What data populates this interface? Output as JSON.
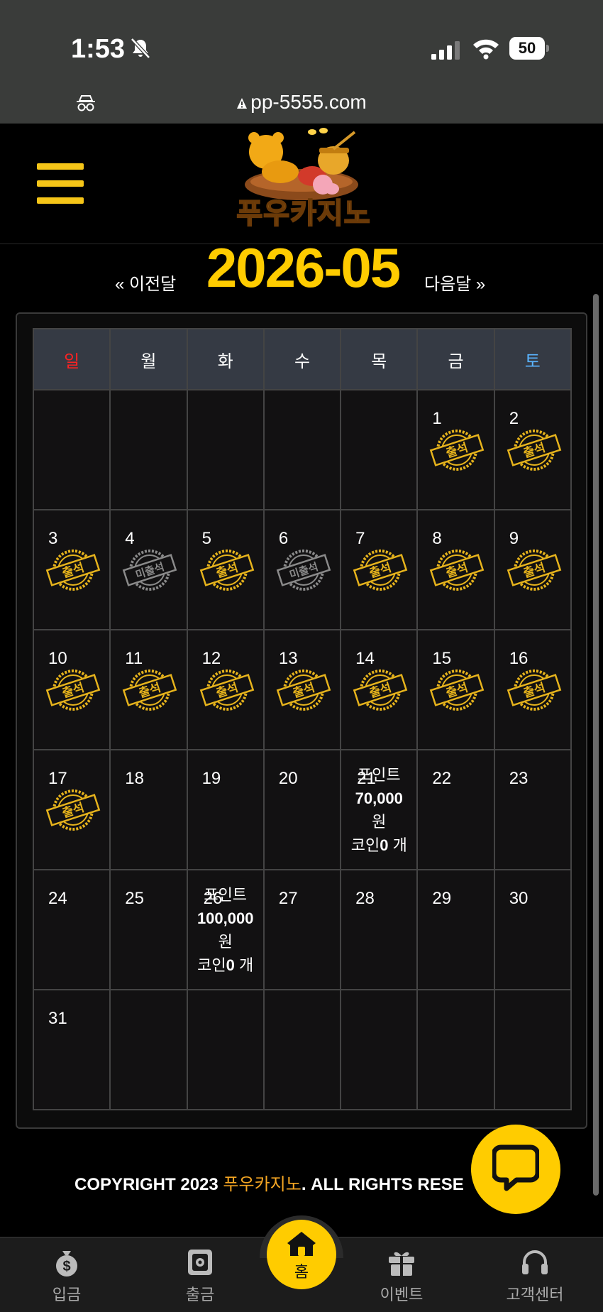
{
  "status_bar": {
    "time": "1:53",
    "battery": "50"
  },
  "browser": {
    "url": "pp-5555.com"
  },
  "header": {
    "logo_text": "푸우카지노"
  },
  "calendar": {
    "title": "2026-05",
    "prev_label": "« 이전달",
    "next_label": "다음달 »",
    "weekdays": [
      "일",
      "월",
      "화",
      "수",
      "목",
      "금",
      "토"
    ],
    "stamp_attended": "출석",
    "stamp_missed": "미출석",
    "days": {
      "d1": "1",
      "d2": "2",
      "d3": "3",
      "d4": "4",
      "d5": "5",
      "d6": "6",
      "d7": "7",
      "d8": "8",
      "d9": "9",
      "d10": "10",
      "d11": "11",
      "d12": "12",
      "d13": "13",
      "d14": "14",
      "d15": "15",
      "d16": "16",
      "d17": "17",
      "d18": "18",
      "d19": "19",
      "d20": "20",
      "d21": "21",
      "d22": "22",
      "d23": "23",
      "d24": "24",
      "d25": "25",
      "d26": "26",
      "d27": "27",
      "d28": "28",
      "d29": "29",
      "d30": "30",
      "d31": "31"
    },
    "rewards": {
      "r21": {
        "label": "포인트",
        "amount": "70,000",
        "unit": "원",
        "coin_label": "코인",
        "coin_count": "0",
        "coin_unit": " 개"
      },
      "r26": {
        "label": "포인트",
        "amount": "100,000",
        "unit": "원",
        "coin_label": "코인",
        "coin_count": "0",
        "coin_unit": " 개"
      }
    }
  },
  "footer": {
    "copyright_prefix": "COPYRIGHT 2023 ",
    "copyright_brand": "푸우카지노",
    "copyright_suffix": ". ALL RIGHTS RESE"
  },
  "bottom_nav": {
    "deposit": "입금",
    "withdraw": "출금",
    "home": "홈",
    "event": "이벤트",
    "support": "고객센터"
  },
  "colors": {
    "accent": "#ffcc00",
    "sunday": "#ff2222",
    "saturday": "#5ab4ff",
    "header_bg": "#353a44"
  }
}
